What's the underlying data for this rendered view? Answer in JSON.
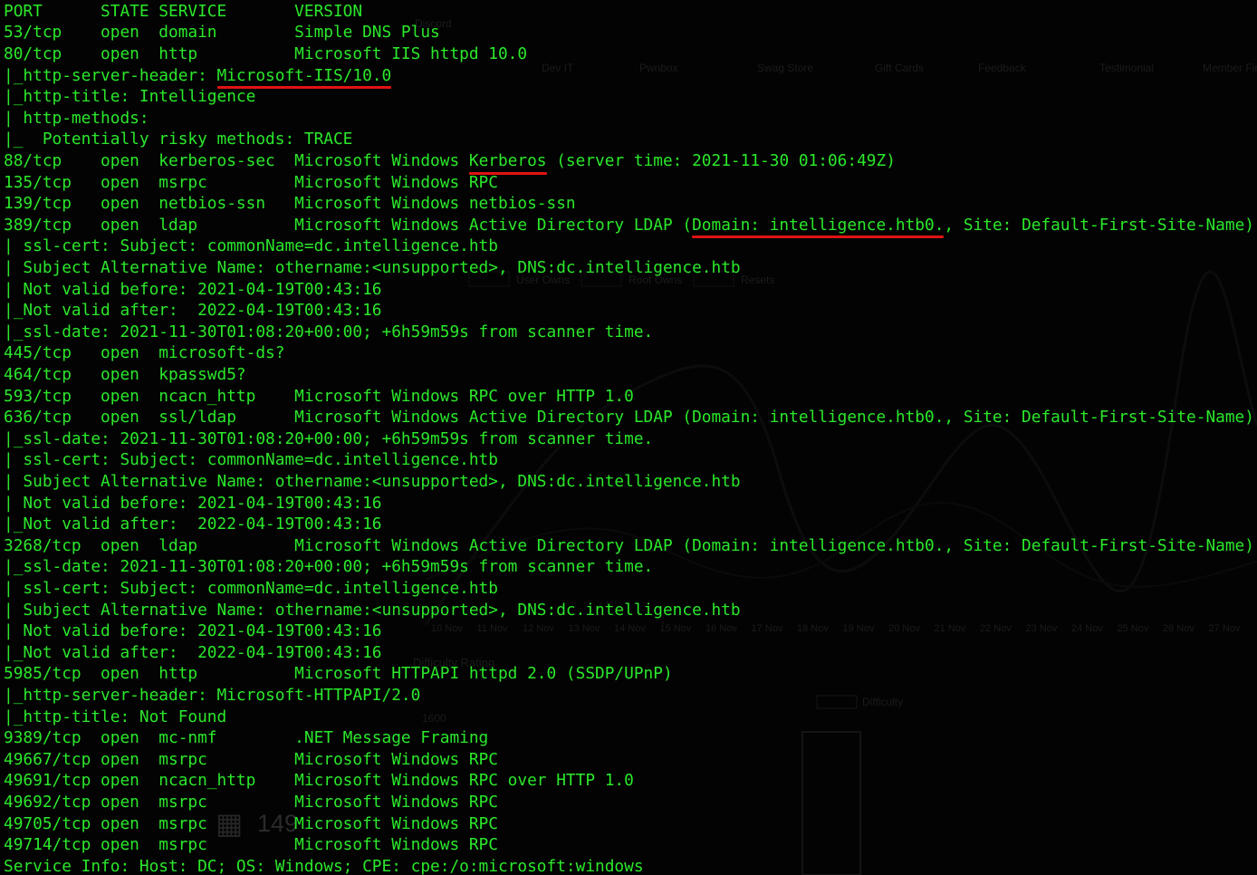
{
  "terminal": {
    "lines": [
      "PORT      STATE SERVICE       VERSION",
      "53/tcp    open  domain        Simple DNS Plus",
      "80/tcp    open  http          Microsoft IIS httpd 10.0",
      "|_http-server-header: Microsoft-IIS/10.0",
      "|_http-title: Intelligence",
      "| http-methods:",
      "|_  Potentially risky methods: TRACE",
      "88/tcp    open  kerberos-sec  Microsoft Windows Kerberos (server time: 2021-11-30 01:06:49Z)",
      "135/tcp   open  msrpc         Microsoft Windows RPC",
      "139/tcp   open  netbios-ssn   Microsoft Windows netbios-ssn",
      "389/tcp   open  ldap          Microsoft Windows Active Directory LDAP (Domain: intelligence.htb0., Site: Default-First-Site-Name)",
      "| ssl-cert: Subject: commonName=dc.intelligence.htb",
      "| Subject Alternative Name: othername:<unsupported>, DNS:dc.intelligence.htb",
      "| Not valid before: 2021-04-19T00:43:16",
      "|_Not valid after:  2022-04-19T00:43:16",
      "|_ssl-date: 2021-11-30T01:08:20+00:00; +6h59m59s from scanner time.",
      "445/tcp   open  microsoft-ds?",
      "464/tcp   open  kpasswd5?",
      "593/tcp   open  ncacn_http    Microsoft Windows RPC over HTTP 1.0",
      "636/tcp   open  ssl/ldap      Microsoft Windows Active Directory LDAP (Domain: intelligence.htb0., Site: Default-First-Site-Name)",
      "|_ssl-date: 2021-11-30T01:08:20+00:00; +6h59m59s from scanner time.",
      "| ssl-cert: Subject: commonName=dc.intelligence.htb",
      "| Subject Alternative Name: othername:<unsupported>, DNS:dc.intelligence.htb",
      "| Not valid before: 2021-04-19T00:43:16",
      "|_Not valid after:  2022-04-19T00:43:16",
      "3268/tcp  open  ldap          Microsoft Windows Active Directory LDAP (Domain: intelligence.htb0., Site: Default-First-Site-Name)",
      "|_ssl-date: 2021-11-30T01:08:20+00:00; +6h59m59s from scanner time.",
      "| ssl-cert: Subject: commonName=dc.intelligence.htb",
      "| Subject Alternative Name: othername:<unsupported>, DNS:dc.intelligence.htb",
      "| Not valid before: 2021-04-19T00:43:16",
      "|_Not valid after:  2022-04-19T00:43:16",
      "5985/tcp  open  http          Microsoft HTTPAPI httpd 2.0 (SSDP/UPnP)",
      "|_http-server-header: Microsoft-HTTPAPI/2.0",
      "|_http-title: Not Found",
      "9389/tcp  open  mc-nmf        .NET Message Framing",
      "49667/tcp open  msrpc         Microsoft Windows RPC",
      "49691/tcp open  ncacn_http    Microsoft Windows RPC over HTTP 1.0",
      "49692/tcp open  msrpc         Microsoft Windows RPC",
      "49705/tcp open  msrpc         Microsoft Windows RPC",
      "49714/tcp open  msrpc         Microsoft Windows RPC",
      "Service Info: Host: DC; OS: Windows; CPE: cpe:/o:microsoft:windows"
    ],
    "highlights": [
      {
        "line": 3,
        "text": "Microsoft-IIS/10.0"
      },
      {
        "line": 7,
        "text": "Kerberos"
      },
      {
        "line": 10,
        "text": "Domain: intelligence.htb0."
      }
    ],
    "colors": {
      "background": "#030303",
      "text": "#2be82b",
      "underline": "#e11313"
    }
  },
  "background_ui": {
    "nav_items": [
      "Discord",
      "Dev IT",
      "Pwnbox",
      "Swag Store",
      "Gift Cards",
      "Feedback",
      "Testimonial",
      "Member Finder"
    ],
    "legend_top": [
      "User Owns",
      "Root Owns",
      "Resets"
    ],
    "date_ticks": [
      "10 Nov",
      "11 Nov",
      "12 Nov",
      "13 Nov",
      "14 Nov",
      "15 Nov",
      "16 Nov",
      "17 Nov",
      "18 Nov",
      "19 Nov",
      "20 Nov",
      "21 Nov",
      "22 Nov",
      "23 Nov",
      "24 Nov",
      "25 Nov",
      "26 Nov",
      "27 Nov"
    ],
    "section_title": "Difficulty Rating",
    "legend_bottom": "Difficulty",
    "y_tick": "1600",
    "count": "149"
  }
}
